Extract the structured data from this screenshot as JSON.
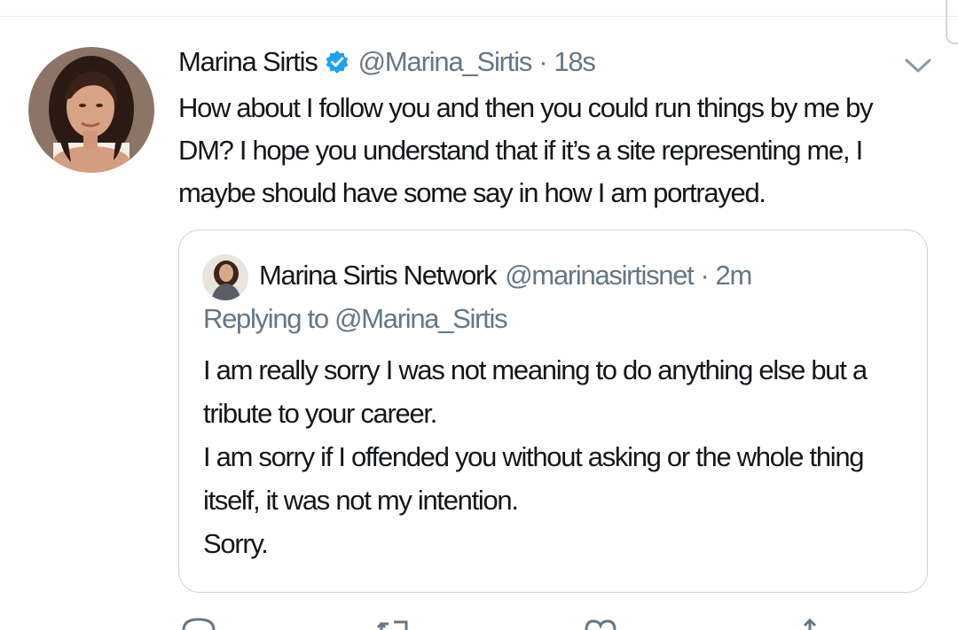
{
  "tweet": {
    "display_name": "Marina Sirtis",
    "handle": "@Marina_Sirtis",
    "separator": "·",
    "time": "18s",
    "text": "How about I follow you and then you could run things by me by DM? I hope you understand that if it’s a site representing me, I maybe should have some say in how I am portrayed."
  },
  "quoted_tweet": {
    "display_name": "Marina Sirtis Network",
    "handle": "@marinasirtisnet",
    "separator": "·",
    "time": "2m",
    "replying_prefix": "Replying to ",
    "replying_to": "@Marina_Sirtis",
    "paragraphs": [
      "I am really sorry I was not meaning to do anything else but a tribute to your career.",
      "I am sorry if I offended you without asking or the whole thing itself, it was not my intention.",
      "Sorry."
    ]
  },
  "icons": {
    "verified": "verified-badge-icon",
    "menu": "chevron-down-icon",
    "reply": "reply-icon",
    "retweet": "retweet-icon",
    "like": "heart-icon",
    "share": "share-icon"
  },
  "colors": {
    "text": "#14171a",
    "secondary": "#657786",
    "verified": "#1da1f2",
    "border": "#ccd6dd"
  }
}
